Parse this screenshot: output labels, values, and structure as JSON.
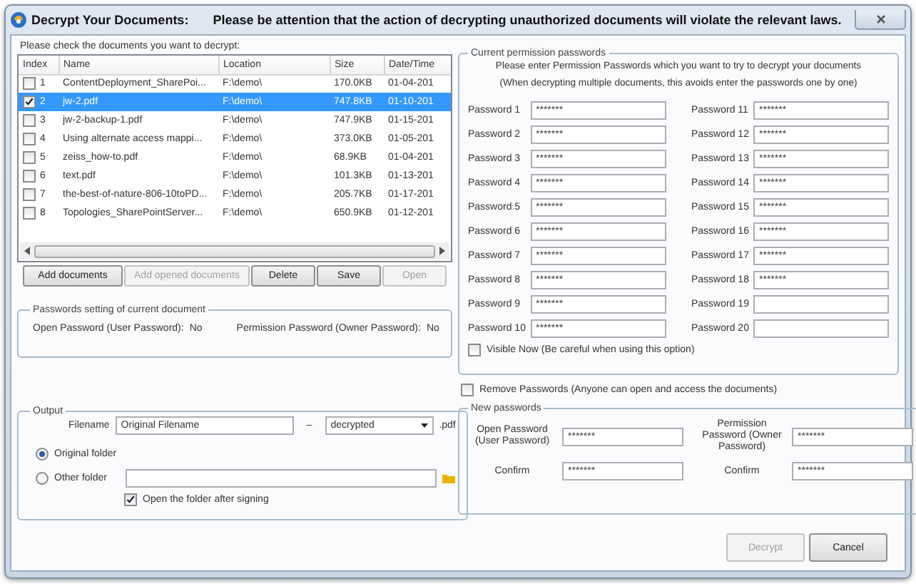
{
  "window": {
    "title": "Decrypt Your Documents:",
    "warning": "Please be attention that the action of decrypting unauthorized documents will violate the relevant laws."
  },
  "documents": {
    "instruction": "Please check the documents you want to decrypt:",
    "columns": [
      "Index",
      "Name",
      "Location",
      "Size",
      "Date/Time"
    ],
    "rows": [
      {
        "index": "1",
        "name": "ContentDeployment_SharePoi...",
        "location": "F:\\demo\\",
        "size": "170.0KB",
        "date": "01-04-201",
        "checked": false,
        "selected": false
      },
      {
        "index": "2",
        "name": "jw-2.pdf",
        "location": "F:\\demo\\",
        "size": "747.8KB",
        "date": "01-10-201",
        "checked": true,
        "selected": true
      },
      {
        "index": "3",
        "name": "jw-2-backup-1.pdf",
        "location": "F:\\demo\\",
        "size": "747.9KB",
        "date": "01-15-201",
        "checked": false,
        "selected": false
      },
      {
        "index": "4",
        "name": "Using alternate access mappi...",
        "location": "F:\\demo\\",
        "size": "373.0KB",
        "date": "01-05-201",
        "checked": false,
        "selected": false
      },
      {
        "index": "5",
        "name": "zeiss_how-to.pdf",
        "location": "F:\\demo\\",
        "size": "68.9KB",
        "date": "01-04-201",
        "checked": false,
        "selected": false
      },
      {
        "index": "6",
        "name": "text.pdf",
        "location": "F:\\demo\\",
        "size": "101.3KB",
        "date": "01-13-201",
        "checked": false,
        "selected": false
      },
      {
        "index": "7",
        "name": "the-best-of-nature-806-10toPD...",
        "location": "F:\\demo\\",
        "size": "205.7KB",
        "date": "01-17-201",
        "checked": false,
        "selected": false
      },
      {
        "index": "8",
        "name": "Topologies_SharePointServer...",
        "location": "F:\\demo\\",
        "size": "650.9KB",
        "date": "01-12-201",
        "checked": false,
        "selected": false
      }
    ],
    "buttons": [
      {
        "label": "Add documents",
        "disabled": false
      },
      {
        "label": "Add opened documents",
        "disabled": true
      },
      {
        "label": "Delete",
        "disabled": false
      },
      {
        "label": "Save",
        "disabled": false
      },
      {
        "label": "Open",
        "disabled": true
      }
    ]
  },
  "password_settings": {
    "title": "Passwords setting of current document",
    "open_label": "Open Password (User Password):",
    "open_value": "No",
    "permission_label": "Permission Password (Owner Password):",
    "permission_value": "No"
  },
  "output": {
    "title": "Output",
    "filename_label": "Filename",
    "filename_value": "Original Filename",
    "separator": "–",
    "suffix": "decrypted",
    "extension": ".pdf",
    "folders": [
      {
        "label": "Original folder",
        "selected": true
      },
      {
        "label": "Other folder",
        "selected": false
      }
    ],
    "open_after": {
      "label": "Open the folder after signing",
      "checked": true
    }
  },
  "permission_passwords": {
    "title": "Current permission passwords",
    "instructions": [
      "Please enter Permission Passwords which you want to try to decrypt your documents",
      "(When decrypting multiple documents, this avoids enter the passwords one by one)"
    ],
    "fields": [
      {
        "label": "Password 1",
        "value": "*******"
      },
      {
        "label": "Password 2",
        "value": "*******"
      },
      {
        "label": "Password 3",
        "value": "*******"
      },
      {
        "label": "Password 4",
        "value": "*******"
      },
      {
        "label": "Password 5",
        "value": "*******"
      },
      {
        "label": "Password 6",
        "value": "*******"
      },
      {
        "label": "Password 7",
        "value": "*******"
      },
      {
        "label": "Password 8",
        "value": "*******"
      },
      {
        "label": "Password 9",
        "value": "*******"
      },
      {
        "label": "Password 10",
        "value": "*******"
      },
      {
        "label": "Password 11",
        "value": "*******"
      },
      {
        "label": "Password 12",
        "value": "*******"
      },
      {
        "label": "Password 13",
        "value": "*******"
      },
      {
        "label": "Password 14",
        "value": "*******"
      },
      {
        "label": "Password 15",
        "value": "*******"
      },
      {
        "label": "Password 16",
        "value": "*******"
      },
      {
        "label": "Password 17",
        "value": "*******"
      },
      {
        "label": "Password 18",
        "value": "*******"
      },
      {
        "label": "Password 19"
      },
      {
        "label": "Password 20"
      }
    ],
    "visible_now": {
      "label": "Visible Now (Be careful when using this option)",
      "checked": false
    }
  },
  "remove_passwords": {
    "label": "Remove Passwords (Anyone can open and access the documents)",
    "checked": false
  },
  "new_passwords": {
    "title": "New passwords",
    "fields": [
      {
        "label": "Open Password (User Password)",
        "value": "*******"
      },
      {
        "label": "Permission Password (Owner Password)",
        "value": "*******"
      },
      {
        "label": "Confirm",
        "value": "*******"
      },
      {
        "label": "Confirm",
        "value": "*******"
      }
    ]
  },
  "buttons": [
    {
      "label": "Decrypt",
      "disabled": true
    },
    {
      "label": "Cancel",
      "disabled": false
    }
  ]
}
